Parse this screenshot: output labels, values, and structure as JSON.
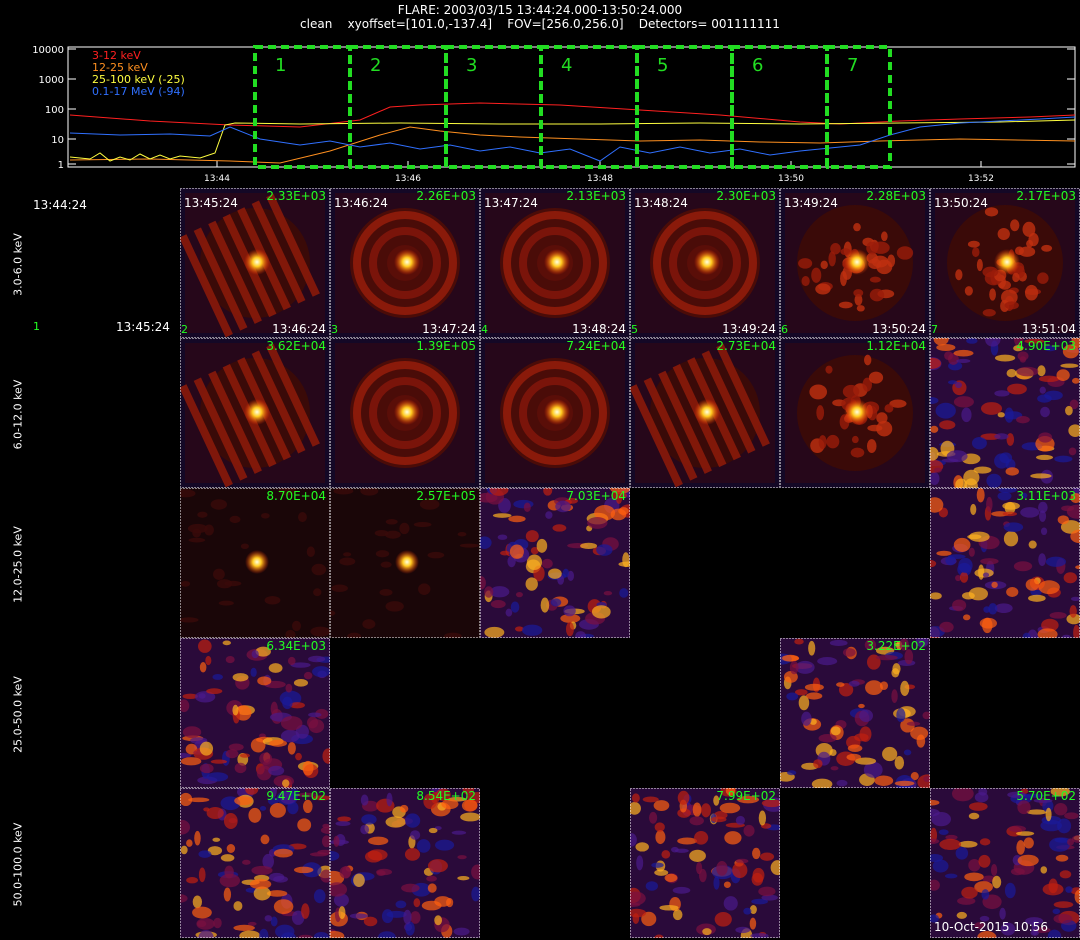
{
  "header": {
    "flare_line": "FLARE: 2003/03/15 13:44:24.000-13:50:24.000",
    "params_line": "clean    xyoffset=[101.0,-137.4]    FOV=[256.0,256.0]    Detectors= 001111111"
  },
  "lightcurve": {
    "y_ticks": [
      "10000",
      "1000",
      "100",
      "10",
      "1"
    ],
    "x_ticks": [
      "13:44",
      "13:46",
      "13:48",
      "13:50",
      "13:52"
    ],
    "legend": [
      {
        "label": "3-12 keV",
        "color": "#ff2020"
      },
      {
        "label": "12-25 keV",
        "color": "#ff9020"
      },
      {
        "label": "25-100 keV (-25)",
        "color": "#ffff40"
      },
      {
        "label": "0.1-17 MeV (-94)",
        "color": "#3070ff"
      }
    ],
    "intervals": [
      "1",
      "2",
      "3",
      "4",
      "5",
      "6",
      "7"
    ],
    "box_color": "#22dd22"
  },
  "panel": {
    "start_time": "13:44:24",
    "first_index": "1",
    "first_end": "13:45:24",
    "footer": "10-Oct-2015 10:56"
  },
  "bands": [
    {
      "label": "3.0-6.0 keV"
    },
    {
      "label": "6.0-12.0 keV"
    },
    {
      "label": "12.0-25.0 keV"
    },
    {
      "label": "25.0-50.0 keV"
    },
    {
      "label": "50.0-100.0 keV"
    }
  ],
  "tiles": [
    {
      "band": 0,
      "col": 0,
      "start": "13:45:24",
      "max": "2.33E+03",
      "index": "2",
      "end": "13:46:24",
      "style": "stripe"
    },
    {
      "band": 0,
      "col": 1,
      "start": "13:46:24",
      "max": "2.26E+03",
      "index": "3",
      "end": "13:47:24",
      "style": "ring"
    },
    {
      "band": 0,
      "col": 2,
      "start": "13:47:24",
      "max": "2.13E+03",
      "index": "4",
      "end": "13:48:24",
      "style": "ring"
    },
    {
      "band": 0,
      "col": 3,
      "start": "13:48:24",
      "max": "2.30E+03",
      "index": "5",
      "end": "13:49:24",
      "style": "ring"
    },
    {
      "band": 0,
      "col": 4,
      "start": "13:49:24",
      "max": "2.28E+03",
      "index": "6",
      "end": "13:50:24",
      "style": "blotch"
    },
    {
      "band": 0,
      "col": 5,
      "start": "13:50:24",
      "max": "2.17E+03",
      "index": "7",
      "end": "13:51:04",
      "style": "blotch"
    },
    {
      "band": 1,
      "col": 0,
      "max": "3.62E+04",
      "style": "stripe"
    },
    {
      "band": 1,
      "col": 1,
      "max": "1.39E+05",
      "style": "ring"
    },
    {
      "band": 1,
      "col": 2,
      "max": "7.24E+04",
      "style": "ring"
    },
    {
      "band": 1,
      "col": 3,
      "max": "2.73E+04",
      "style": "stripe"
    },
    {
      "band": 1,
      "col": 4,
      "max": "1.12E+04",
      "style": "blotch"
    },
    {
      "band": 1,
      "col": 5,
      "max": "4.90E+03",
      "style": "noise"
    },
    {
      "band": 2,
      "col": 0,
      "max": "8.70E+04",
      "style": "dot"
    },
    {
      "band": 2,
      "col": 1,
      "max": "2.57E+05",
      "style": "dot"
    },
    {
      "band": 2,
      "col": 2,
      "max": "7.03E+04",
      "style": "noise"
    },
    {
      "band": 2,
      "col": 5,
      "max": "3.11E+03",
      "style": "noise"
    },
    {
      "band": 3,
      "col": 0,
      "max": "6.34E+03",
      "style": "noise"
    },
    {
      "band": 3,
      "col": 4,
      "max": "3.22E+02",
      "style": "noise"
    },
    {
      "band": 4,
      "col": 0,
      "max": "9.47E+02",
      "style": "noise"
    },
    {
      "band": 4,
      "col": 1,
      "max": "8.54E+02",
      "style": "noise"
    },
    {
      "band": 4,
      "col": 3,
      "max": "7.99E+02",
      "style": "noise"
    },
    {
      "band": 4,
      "col": 5,
      "max": "5.70E+02",
      "style": "noise"
    }
  ]
}
